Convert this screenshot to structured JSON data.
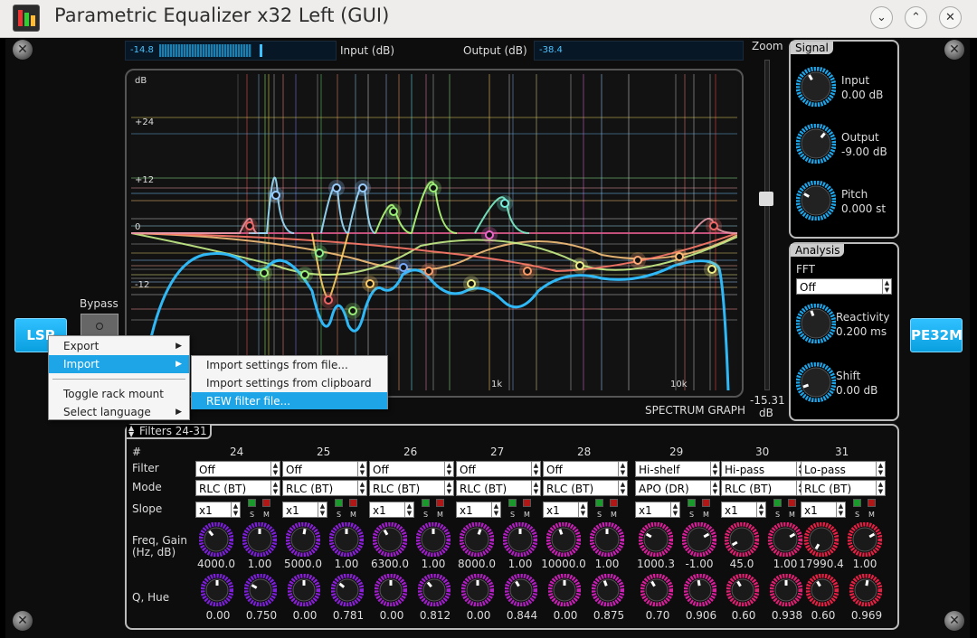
{
  "window": {
    "title": "Parametric Equalizer x32 Left (GUI)",
    "buttons": {
      "minimize": "⌄",
      "maximize": "⌃",
      "close": "✕"
    }
  },
  "logo_left": "LSP",
  "logo_right": "PE32M",
  "bypass": {
    "label": "Bypass"
  },
  "meters": {
    "input_value": "-14.8",
    "input_label": "Input (dB)",
    "output_label": "Output (dB)",
    "output_value": "-38.4"
  },
  "graph": {
    "y_labels": [
      "dB",
      "+24",
      "+12",
      "0",
      "-12"
    ],
    "x_labels": [
      "1k",
      "10k"
    ],
    "caption": "SPECTRUM GRAPH"
  },
  "zoom": {
    "label": "Zoom",
    "value": "-15.31",
    "unit": "dB"
  },
  "signal": {
    "title": "Signal",
    "knobs": [
      {
        "label": "Input",
        "value": "0.00 dB"
      },
      {
        "label": "Output",
        "value": "-9.00 dB"
      },
      {
        "label": "Pitch",
        "value": "0.000 st"
      }
    ]
  },
  "analysis": {
    "title": "Analysis",
    "fft_label": "FFT",
    "fft_value": "Off",
    "knobs": [
      {
        "label": "Reactivity",
        "value": "0.200 ms"
      },
      {
        "label": "Shift",
        "value": "0.00 dB"
      }
    ]
  },
  "filters": {
    "group": "Filters 24-31",
    "row_labels": {
      "num": "#",
      "filter": "Filter",
      "mode": "Mode",
      "slope": "Slope",
      "freq": "Freq, Gain",
      "freq2": "(Hz, dB)",
      "q": "Q, Hue"
    },
    "solo": "S",
    "mute": "M",
    "columns": [
      {
        "num": "24",
        "filter": "Off",
        "mode": "RLC (BT)",
        "slope": "x1",
        "freq": "4000.0",
        "gain": "1.00",
        "q": "0.00",
        "hue": "0.750"
      },
      {
        "num": "25",
        "filter": "Off",
        "mode": "RLC (BT)",
        "slope": "x1",
        "freq": "5000.0",
        "gain": "1.00",
        "q": "0.00",
        "hue": "0.781"
      },
      {
        "num": "26",
        "filter": "Off",
        "mode": "RLC (BT)",
        "slope": "x1",
        "freq": "6300.0",
        "gain": "1.00",
        "q": "0.00",
        "hue": "0.812"
      },
      {
        "num": "27",
        "filter": "Off",
        "mode": "RLC (BT)",
        "slope": "x1",
        "freq": "8000.0",
        "gain": "1.00",
        "q": "0.00",
        "hue": "0.844"
      },
      {
        "num": "28",
        "filter": "Off",
        "mode": "RLC (BT)",
        "slope": "x1",
        "freq": "10000.0",
        "gain": "1.00",
        "q": "0.00",
        "hue": "0.875"
      },
      {
        "num": "29",
        "filter": "Hi-shelf",
        "mode": "APO (DR)",
        "slope": "x1",
        "freq": "1000.3",
        "gain": "-1.00",
        "q": "0.70",
        "hue": "0.906"
      },
      {
        "num": "30",
        "filter": "Hi-pass",
        "mode": "RLC (BT)",
        "slope": "x1",
        "freq": "45.0",
        "gain": "1.00",
        "q": "0.60",
        "hue": "0.938"
      },
      {
        "num": "31",
        "filter": "Lo-pass",
        "mode": "RLC (BT)",
        "slope": "x1",
        "freq": "17990.4",
        "gain": "1.00",
        "q": "0.60",
        "hue": "0.969"
      }
    ]
  },
  "context_menu": {
    "items": [
      "Export",
      "Import",
      "Toggle rack mount",
      "Select language"
    ],
    "submenu": [
      "Import settings from file...",
      "Import settings from clipboard",
      "REW filter file..."
    ]
  }
}
